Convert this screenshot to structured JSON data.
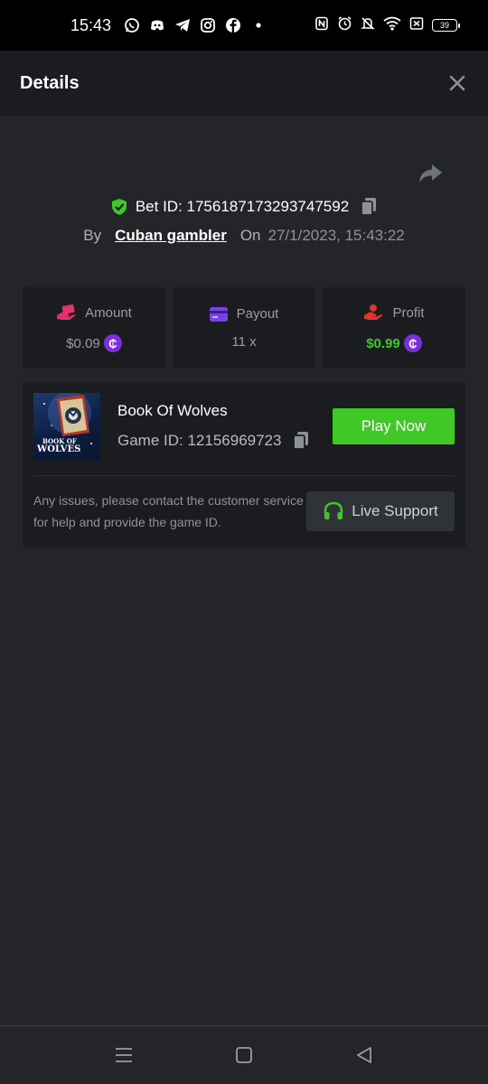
{
  "status_bar": {
    "time": "15:43",
    "battery": "39",
    "left_icons": [
      "whatsapp-icon",
      "discord-icon",
      "telegram-icon",
      "instagram-icon",
      "facebook-icon",
      "dot-icon"
    ],
    "right_icons": [
      "nfc-icon",
      "alarm-icon",
      "bell-off-icon",
      "wifi-icon",
      "sim-x-icon",
      "battery-icon"
    ]
  },
  "header": {
    "title": "Details"
  },
  "bet": {
    "id_text": "Bet ID: 1756187173293747592",
    "by_label": "By",
    "user": "Cuban gambler",
    "on_label": "On",
    "date": "27/1/2023, 15:43:22"
  },
  "stats": {
    "amount": {
      "label": "Amount",
      "value": "$0.09"
    },
    "payout": {
      "label": "Payout",
      "value": "11 x"
    },
    "profit": {
      "label": "Profit",
      "value": "$0.99"
    },
    "coin_symbol": "₵"
  },
  "game": {
    "name": "Book Of Wolves",
    "id_text": "Game ID: 12156969723",
    "thumb_line1": "BOOK OF",
    "thumb_line2": "WOLVES",
    "play_label": "Play Now"
  },
  "support": {
    "help_text": "Any issues, please contact the customer service for help and provide the game ID.",
    "live_label": "Live Support"
  },
  "colors": {
    "accent_green": "#3fc826",
    "coin_purple": "#7b2fd8",
    "background": "#232528",
    "card": "#1b1c1f"
  }
}
